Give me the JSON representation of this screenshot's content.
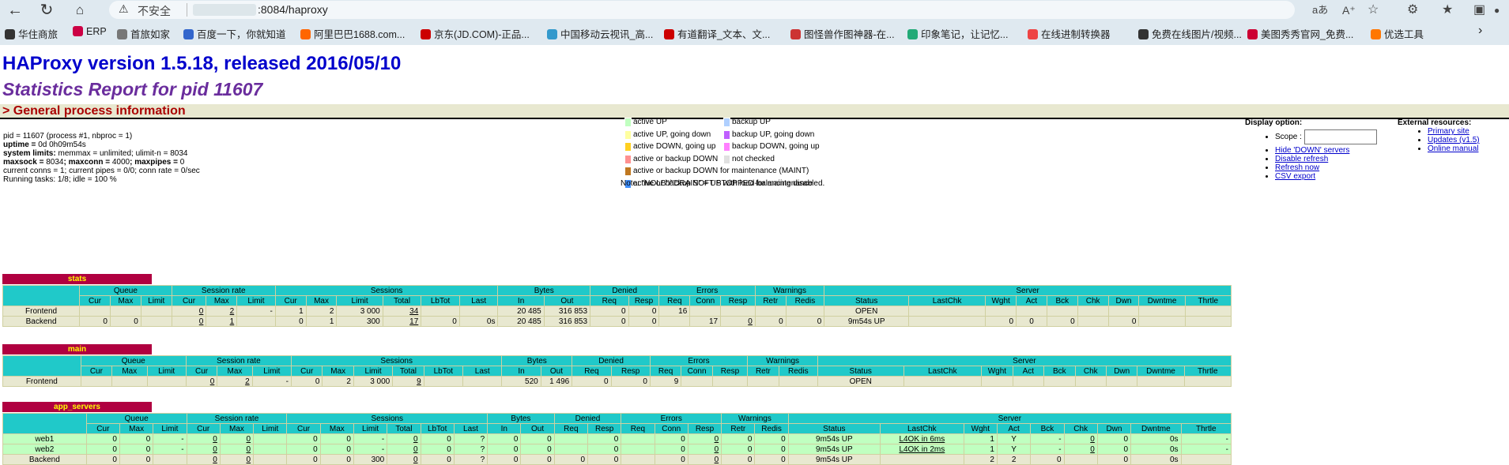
{
  "browser": {
    "insecure_label": "不安全",
    "url": ":8084/haproxy",
    "reader_aA": "aあ",
    "bookmarks": [
      "华住商旅",
      "ERP",
      "首旅如家",
      "百度一下，你就知道",
      "阿里巴巴1688.com...",
      "京东(JD.COM)-正品...",
      "中国移动云视讯_高...",
      "有道翻译_文本、文...",
      "图怪兽作图神器-在...",
      "印象笔记，让记忆...",
      "在线进制转换器",
      "免费在线图片/视频...",
      "美图秀秀官网_免费...",
      "优选工具"
    ]
  },
  "header": {
    "title": "HAProxy version 1.5.18, released 2016/05/10",
    "subtitle": "Statistics Report for pid 11607",
    "section": "> General process information"
  },
  "process": {
    "pid_line": "pid = 11607 (process #1, nbproc = 1)",
    "uptime_label": "uptime = ",
    "uptime": "0d 0h09m54s",
    "limits_label": "system limits: ",
    "limits": "memmax = unlimited; ulimit-n = 8034",
    "maxsock_label": "maxsock = ",
    "maxsock": "8034",
    "maxconn_label": "; maxconn = ",
    "maxconn": "4000",
    "maxpipes_label": "; maxpipes = ",
    "maxpipes": "0",
    "conns_line": "current conns = 1; current pipes = 0/0; conn rate = 0/sec",
    "tasks_line": "Running tasks: 1/8; idle = 100 %"
  },
  "legend": {
    "left": [
      "active UP",
      "active UP, going down",
      "active DOWN, going up",
      "active or backup DOWN",
      "active or backup DOWN for maintenance (MAINT)",
      "active or backup SOFT STOPPED for maintenance"
    ],
    "left_colors": [
      "#c0ffc0",
      "#ffffa0",
      "#ffd020",
      "#ff9090",
      "#c07820",
      "#4090ff"
    ],
    "right": [
      "backup UP",
      "backup UP, going down",
      "backup DOWN, going up",
      "not checked"
    ],
    "right_colors": [
      "#b0d0ff",
      "#c060ff",
      "#ff80ff",
      "#e0e0e0"
    ],
    "note": "Note: \"NOLB\"/\"DRAIN\" = UP with load-balancing disabled."
  },
  "display": {
    "heading": "Display option:",
    "scope_label": "Scope : ",
    "links": [
      "Hide 'DOWN' servers",
      "Disable refresh",
      "Refresh now",
      "CSV export"
    ]
  },
  "external": {
    "heading": "External resources:",
    "links": [
      "Primary site",
      "Updates (v1.5)",
      "Online manual"
    ]
  },
  "table_headers": {
    "groups": [
      "Queue",
      "Session rate",
      "Sessions",
      "Bytes",
      "Denied",
      "Errors",
      "Warnings",
      "Server"
    ],
    "cols": [
      "Cur",
      "Max",
      "Limit",
      "Cur",
      "Max",
      "Limit",
      "Cur",
      "Max",
      "Limit",
      "Total",
      "LbTot",
      "Last",
      "In",
      "Out",
      "Req",
      "Resp",
      "Req",
      "Conn",
      "Resp",
      "Retr",
      "Redis",
      "Status",
      "LastChk",
      "Wght",
      "Act",
      "Bck",
      "Chk",
      "Dwn",
      "Dwntme",
      "Thrtle"
    ]
  },
  "proxies": [
    {
      "name": "stats",
      "rows": [
        {
          "kind": "fe",
          "label": "Frontend",
          "cells": [
            "",
            "",
            "",
            "0",
            "2",
            "-",
            "1",
            "2",
            "3 000",
            "34",
            "",
            "",
            "20 485",
            "316 853",
            "0",
            "0",
            "16",
            "",
            "",
            "",
            "",
            "OPEN",
            "",
            "",
            "",
            "",
            "",
            "",
            "",
            ""
          ]
        },
        {
          "kind": "be",
          "label": "Backend",
          "cells": [
            "0",
            "0",
            "",
            "0",
            "1",
            "",
            "0",
            "1",
            "300",
            "17",
            "0",
            "0s",
            "20 485",
            "316 853",
            "0",
            "0",
            "",
            "17",
            "0",
            "0",
            "0",
            "9m54s UP",
            "",
            "0",
            "0",
            "0",
            "",
            "0",
            "",
            ""
          ]
        }
      ]
    },
    {
      "name": "main",
      "rows": [
        {
          "kind": "fe",
          "label": "Frontend",
          "cells": [
            "",
            "",
            "",
            "0",
            "2",
            "-",
            "0",
            "2",
            "3 000",
            "9",
            "",
            "",
            "520",
            "1 496",
            "0",
            "0",
            "9",
            "",
            "",
            "",
            "",
            "OPEN",
            "",
            "",
            "",
            "",
            "",
            "",
            "",
            ""
          ]
        }
      ]
    },
    {
      "name": "app_servers",
      "rows": [
        {
          "kind": "up",
          "label": "web1",
          "cells": [
            "0",
            "0",
            "-",
            "0",
            "0",
            "",
            "0",
            "0",
            "-",
            "0",
            "0",
            "?",
            "0",
            "0",
            "",
            "0",
            "",
            "0",
            "0",
            "0",
            "0",
            "9m54s UP",
            "L4OK in 6ms",
            "1",
            "Y",
            "-",
            "0",
            "0",
            "0s",
            "-"
          ]
        },
        {
          "kind": "up",
          "label": "web2",
          "cells": [
            "0",
            "0",
            "-",
            "0",
            "0",
            "",
            "0",
            "0",
            "-",
            "0",
            "0",
            "?",
            "0",
            "0",
            "",
            "0",
            "",
            "0",
            "0",
            "0",
            "0",
            "9m54s UP",
            "L4OK in 2ms",
            "1",
            "Y",
            "-",
            "0",
            "0",
            "0s",
            "-"
          ]
        },
        {
          "kind": "be",
          "label": "Backend",
          "cells": [
            "0",
            "0",
            "",
            "0",
            "0",
            "",
            "0",
            "0",
            "300",
            "0",
            "0",
            "?",
            "0",
            "0",
            "0",
            "0",
            "",
            "0",
            "0",
            "0",
            "0",
            "9m54s UP",
            "",
            "2",
            "2",
            "0",
            "",
            "0",
            "0s",
            ""
          ]
        }
      ]
    }
  ]
}
